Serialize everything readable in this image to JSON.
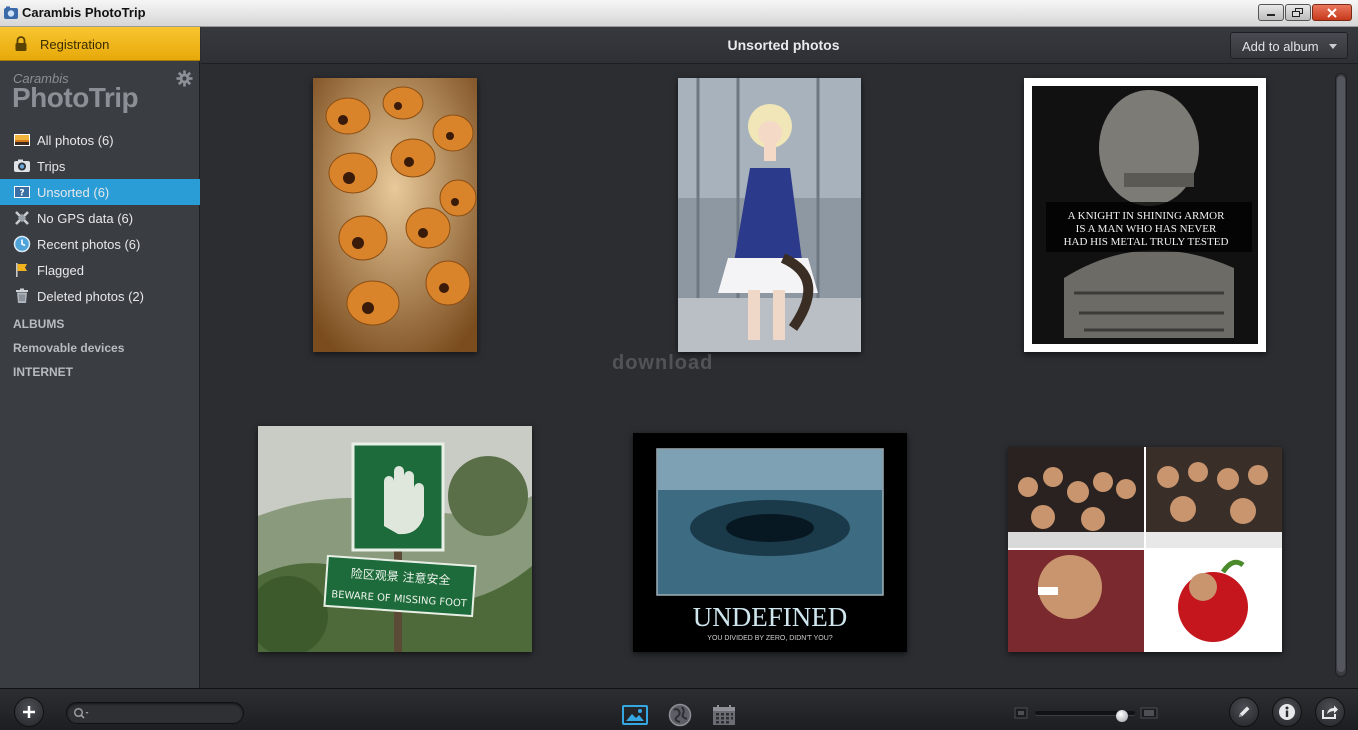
{
  "window": {
    "title": "Carambis PhotoTrip"
  },
  "sidebar": {
    "registration_label": "Registration",
    "brand_small": "Carambis",
    "brand_big": "PhotoTrip",
    "items": [
      {
        "label": "All photos (6)",
        "icon": "photos-icon"
      },
      {
        "label": "Trips",
        "icon": "camera-icon"
      },
      {
        "label": "Unsorted (6)",
        "icon": "unsorted-icon",
        "active": true
      },
      {
        "label": "No GPS data (6)",
        "icon": "no-gps-icon"
      },
      {
        "label": "Recent photos (6)",
        "icon": "clock-icon"
      },
      {
        "label": "Flagged",
        "icon": "flag-icon"
      },
      {
        "label": "Deleted photos (2)",
        "icon": "trash-icon"
      }
    ],
    "sections": {
      "albums": "ALBUMS",
      "removable": "Removable devices",
      "internet": "INTERNET"
    }
  },
  "main": {
    "title": "Unsorted photos",
    "add_album_label": "Add to album",
    "watermark": "download",
    "photos": [
      {
        "subject": "bread-creatures",
        "caption": ""
      },
      {
        "subject": "cosplay-girl",
        "caption": ""
      },
      {
        "subject": "knight-armor",
        "caption": "A KNIGHT IN SHINING ARMOR IS A MAN WHO HAS NEVER HAD HIS METAL TRULY TESTED"
      },
      {
        "subject": "warning-sign",
        "caption": "BEWARE OF MISSING FOOT",
        "caption_cn": "险区观景  注意安全"
      },
      {
        "subject": "undefined-poster",
        "caption": "UNDEFINED",
        "subcaption": "YOU DIVIDED BY ZERO, DIDN'T YOU?"
      },
      {
        "subject": "group-collage",
        "caption": ""
      }
    ]
  },
  "bottom": {
    "search_placeholder": "",
    "zoom_level": 0.87
  },
  "colors": {
    "accent": "#2a9dd6",
    "registration": "#f2b91a",
    "background": "#2b2d31"
  }
}
